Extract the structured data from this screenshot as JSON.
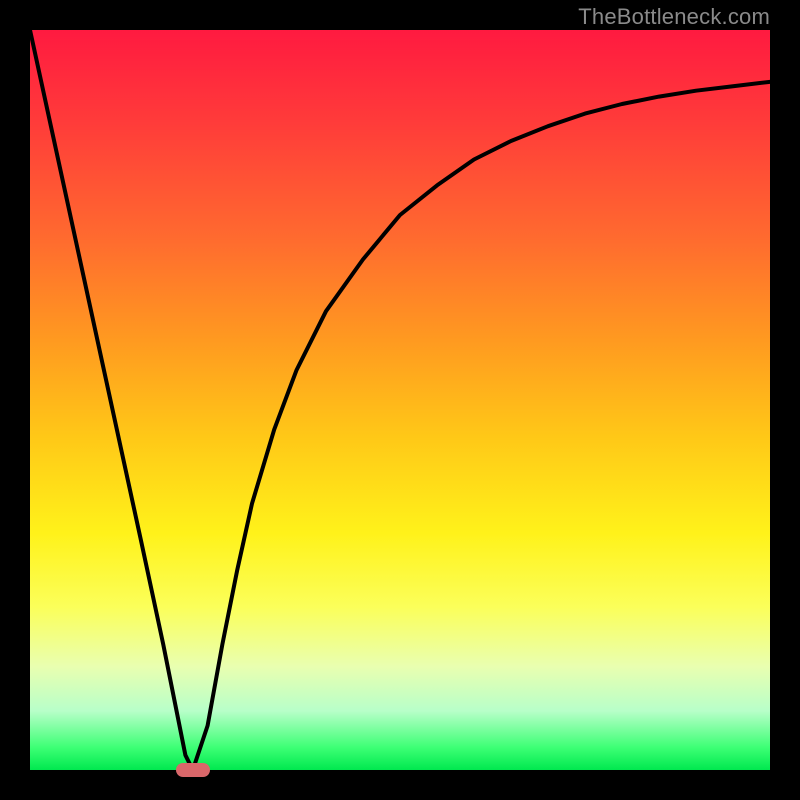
{
  "watermark": "TheBottleneck.com",
  "chart_data": {
    "type": "line",
    "title": "",
    "xlabel": "",
    "ylabel": "",
    "xlim": [
      0,
      100
    ],
    "ylim": [
      0,
      100
    ],
    "grid": false,
    "series": [
      {
        "name": "curve",
        "x": [
          0,
          5,
          10,
          15,
          18,
          20,
          21,
          22,
          24,
          26,
          28,
          30,
          33,
          36,
          40,
          45,
          50,
          55,
          60,
          65,
          70,
          75,
          80,
          85,
          90,
          95,
          100
        ],
        "y": [
          100,
          77,
          54,
          31,
          17,
          7,
          2,
          0,
          6,
          17,
          27,
          36,
          46,
          54,
          62,
          69,
          75,
          79,
          82.5,
          85,
          87,
          88.7,
          90,
          91,
          91.8,
          92.4,
          93
        ]
      }
    ],
    "marker": {
      "x": 22,
      "y": 0,
      "color": "#d9676a"
    },
    "background_gradient": {
      "top": "#ff1a40",
      "bottom": "#00e84f"
    }
  }
}
